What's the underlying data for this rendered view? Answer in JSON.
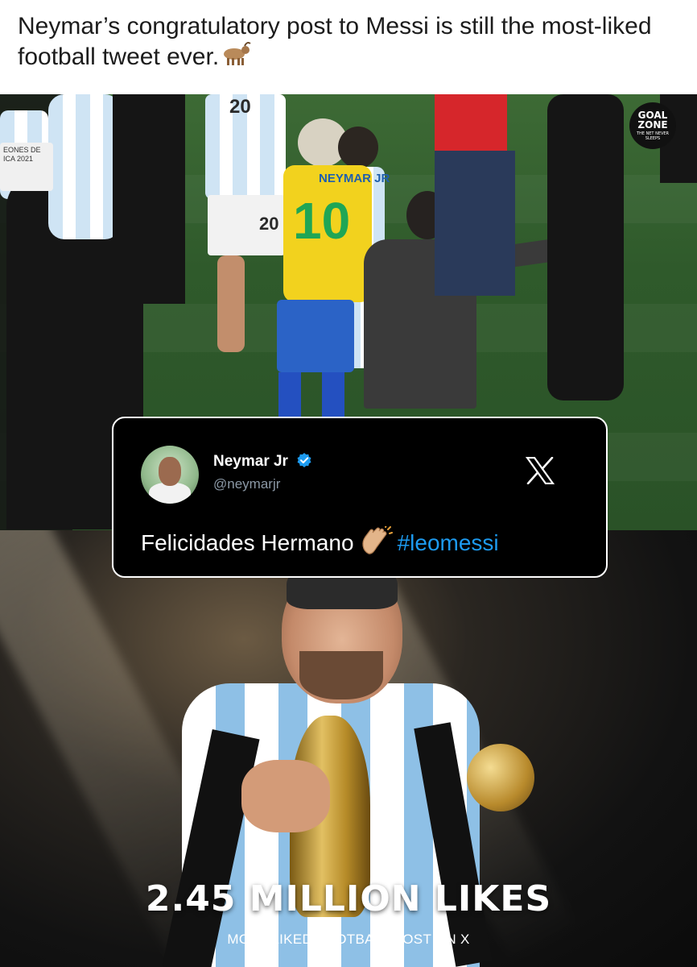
{
  "caption": {
    "text": "Neymar’s congratulatory post to Messi is still the most-liked football tweet ever.",
    "emoji": "goat"
  },
  "top_photo": {
    "jersey_numbers": [
      "20",
      "20",
      "10"
    ],
    "jersey_name": "NEYMAR JR",
    "sideline_text": "EONES DE\nICA 2021",
    "logo": {
      "line1": "GOAL",
      "line2": "ZONE",
      "tagline": "THE NET NEVER SLEEPS"
    }
  },
  "tweet": {
    "display_name": "Neymar Jr",
    "handle": "@neymarjr",
    "text": "Felicidades Hermano",
    "emoji": "clapping-hands",
    "hashtag": "#leomessi",
    "platform_icon": "x-logo",
    "verified": true,
    "colors": {
      "background": "#000000",
      "hashtag": "#1d9bf0",
      "verified": "#1d9bf0",
      "handle": "#8b98a5"
    }
  },
  "bottom_photo": {
    "headline": "2.45 MILLION LIKES",
    "subheadline": "MOST LIKED FOOTBALL POST ON X"
  }
}
